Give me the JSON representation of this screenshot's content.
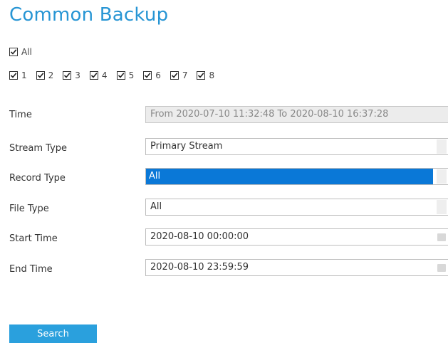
{
  "page_title": "Common Backup",
  "all_checkbox": {
    "label": "All",
    "checked": true
  },
  "channels": [
    {
      "label": "1",
      "checked": true
    },
    {
      "label": "2",
      "checked": true
    },
    {
      "label": "3",
      "checked": true
    },
    {
      "label": "4",
      "checked": true
    },
    {
      "label": "5",
      "checked": true
    },
    {
      "label": "6",
      "checked": true
    },
    {
      "label": "7",
      "checked": true
    },
    {
      "label": "8",
      "checked": true
    }
  ],
  "form": {
    "time": {
      "label": "Time",
      "value": "From 2020-07-10 11:32:48 To 2020-08-10 16:37:28"
    },
    "stream_type": {
      "label": "Stream Type",
      "value": "Primary Stream"
    },
    "record_type": {
      "label": "Record Type",
      "value": "All"
    },
    "file_type": {
      "label": "File Type",
      "value": "All"
    },
    "start_time": {
      "label": "Start Time",
      "value": "2020-08-10 00:00:00"
    },
    "end_time": {
      "label": "End Time",
      "value": "2020-08-10 23:59:59"
    }
  },
  "search_button": "Search",
  "colors": {
    "accent": "#2795d4",
    "button": "#2aa0dd",
    "highlight": "#0a78d7"
  }
}
